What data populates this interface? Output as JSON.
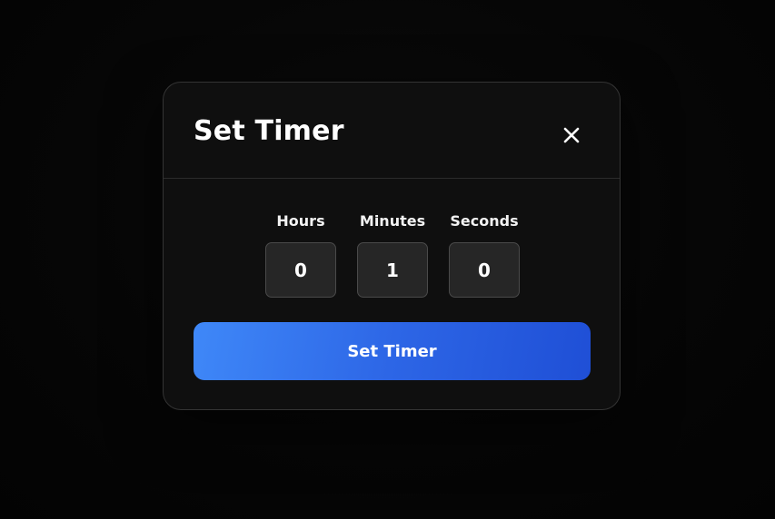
{
  "dialog": {
    "title": "Set Timer",
    "close_icon": "close-icon"
  },
  "fields": {
    "hours": {
      "label": "Hours",
      "value": "0"
    },
    "minutes": {
      "label": "Minutes",
      "value": "1"
    },
    "seconds": {
      "label": "Seconds",
      "value": "0"
    }
  },
  "submit": {
    "label": "Set Timer"
  },
  "colors": {
    "background": "#040404",
    "modal_background": "#0f0f0f",
    "input_background": "#262626",
    "accent_start": "#3f88f8",
    "accent_end": "#1f4fd6",
    "text": "#ffffff"
  }
}
